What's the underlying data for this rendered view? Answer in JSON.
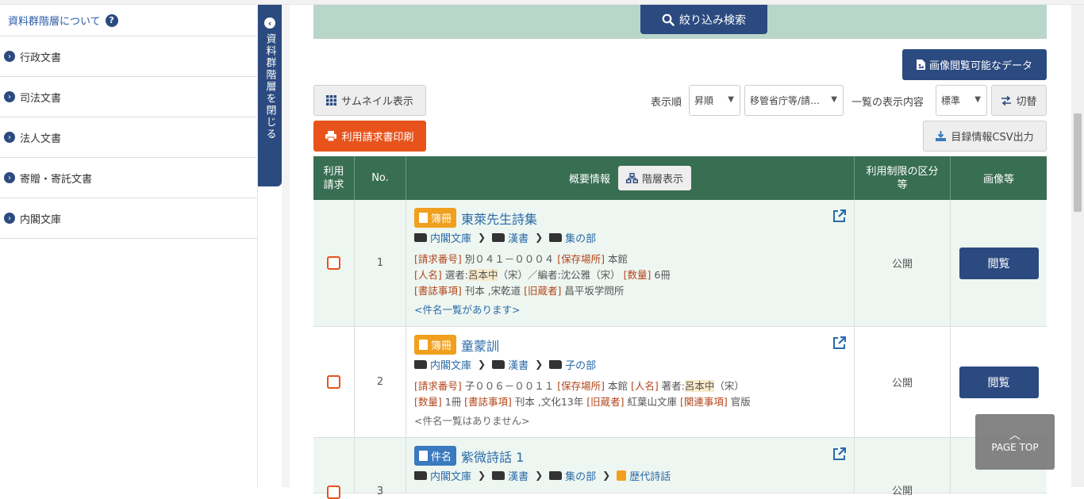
{
  "sidebar": {
    "header": "資料群階層について",
    "items": [
      {
        "label": "行政文書"
      },
      {
        "label": "司法文書"
      },
      {
        "label": "法人文書"
      },
      {
        "label": "寄贈・寄託文書"
      },
      {
        "label": "内閣文庫"
      }
    ],
    "close_label": "資料群階層を閉じる"
  },
  "toolbar": {
    "search_label": "絞り込み検索",
    "image_data_label": "画像閲覧可能なデータ",
    "thumbnail_label": "サムネイル表示",
    "print_label": "利用請求書印刷",
    "sort_label": "表示順",
    "sort_order": "昇順",
    "sort_key": "移管省庁等/請…",
    "display_label": "一覧の表示内容",
    "display_value": "標準",
    "switch_label": "切替",
    "csv_label": "目録情報CSV出力"
  },
  "table": {
    "headers": {
      "request": "利用\n請求",
      "no": "No.",
      "summary": "概要情報",
      "tree_button": "階層表示",
      "restriction": "利用制限の区分等",
      "images": "画像等"
    },
    "rows": [
      {
        "no": "1",
        "badge": "簿冊",
        "title": "東萊先生詩集",
        "path": [
          "内閣文庫",
          "漢書",
          "集の部"
        ],
        "meta1": [
          [
            "[請求番号]",
            " 別０４１－０００４ "
          ],
          [
            "[保存場所]",
            " 本館"
          ]
        ],
        "meta2_key1": "[人名]",
        "meta2_val1a": " 選者:",
        "meta2_hl": "呂本中",
        "meta2_val1b": "（宋）／編者:沈公雅（宋） ",
        "meta2_key2": "[数量]",
        "meta2_val2": " 6冊",
        "meta3": [
          [
            "[書誌事項]",
            " 刊本 ,宋乾道 "
          ],
          [
            "[旧蔵者]",
            " 昌平坂学問所"
          ]
        ],
        "link": "<件名一覧があります>",
        "restriction": "公開",
        "view": "閲覧"
      },
      {
        "no": "2",
        "badge": "簿冊",
        "title": "童蒙訓",
        "path": [
          "内閣文庫",
          "漢書",
          "子の部"
        ],
        "meta1_key1": "[請求番号]",
        "meta1_val1": " 子００６－００１１ ",
        "meta1_key2": "[保存場所]",
        "meta1_val2": " 本館 ",
        "meta1_key3": "[人名]",
        "meta1_val3a": " 著者:",
        "meta1_hl": "呂本中",
        "meta1_val3b": "（宋）",
        "meta2": [
          [
            "[数量]",
            " 1冊 "
          ],
          [
            "[書誌事項]",
            " 刊本 ,文化13年 "
          ],
          [
            "[旧蔵者]",
            " 紅葉山文庫 "
          ],
          [
            "[関連事項]",
            " 官版"
          ]
        ],
        "link": "<件名一覧はありません>",
        "restriction": "公開",
        "view": "閲覧"
      },
      {
        "no": "3",
        "badge": "件名",
        "title": "紫微詩話 1",
        "path": [
          "内閣文庫",
          "漢書",
          "集の部",
          "歴代詩話"
        ],
        "restriction": "公開"
      }
    ]
  },
  "pagetop": "PAGE TOP"
}
